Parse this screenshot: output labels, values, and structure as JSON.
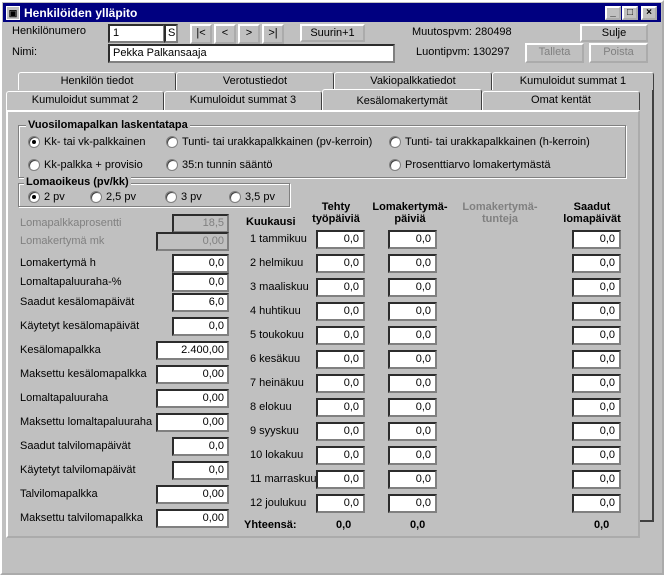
{
  "window": {
    "title": "Henkilöiden ylläpito"
  },
  "header": {
    "employee_number_label": "Henkilönumero",
    "employee_number": "1",
    "s_label": "S",
    "nav_first": "|<",
    "nav_prev": "<",
    "nav_next": ">",
    "nav_last": ">|",
    "largest_button": "Suurin+1",
    "modified_label": "Muutospvm: 280498",
    "close_button": "Sulje",
    "name_label": "Nimi:",
    "name_value": "Pekka Palkansaaja",
    "created_label": "Luontipvm: 130297",
    "save_button": "Talleta",
    "delete_button": "Poista"
  },
  "tabs_back": [
    "Henkilön tiedot",
    "Verotustiedot",
    "Vakiopalkkatiedot",
    "Kumuloidut summat 1"
  ],
  "tabs_front": [
    "Kumuloidut summat 2",
    "Kumuloidut summat 3",
    "Kesälomakertymät",
    "Omat kentät"
  ],
  "calc_group": {
    "title": "Vuosilomapalkan laskentatapa",
    "options": [
      "Kk- tai vk-palkkainen",
      "Tunti- tai urakkapalkkainen (pv-kerroin)",
      "Tunti- tai urakkapalkkainen (h-kerroin)",
      "Kk-palkka + provisio",
      "35:n tunnin sääntö",
      "Prosenttiarvo lomakertymästä"
    ]
  },
  "leave_group": {
    "title": "Lomaoikeus (pv/kk)",
    "options": [
      "2 pv",
      "2,5 pv",
      "3 pv",
      "3,5 pv"
    ]
  },
  "fields": [
    {
      "label": "Lomapalkkaprosentti",
      "value": "18,5"
    },
    {
      "label": "Lomakertymä mk",
      "value": "0,00"
    },
    {
      "label": "Lomakertymä h",
      "value": "0,0"
    },
    {
      "label": "Lomaltapaluuraha-%",
      "value": "0,0"
    },
    {
      "label": "Saadut kesälomapäivät",
      "value": "6,0"
    },
    {
      "label": "Käytetyt kesälomapäivät",
      "value": "0,0"
    },
    {
      "label": "Kesälomapalkka",
      "value": "2.400,00"
    },
    {
      "label": "Maksettu kesälomapalkka",
      "value": "0,00"
    },
    {
      "label": "Lomaltapaluuraha",
      "value": "0,00"
    },
    {
      "label": "Maksettu lomaltapaluuraha",
      "value": "0,00"
    },
    {
      "label": "Saadut talvilomapäivät",
      "value": "0,0"
    },
    {
      "label": "Käytetyt talvilomapäivät",
      "value": "0,0"
    },
    {
      "label": "Talvilomapalkka",
      "value": "0,00"
    },
    {
      "label": "Maksettu talvilomapalkka",
      "value": "0,00"
    }
  ],
  "table": {
    "col_month": "Kuukausi",
    "col_worked_1": "Tehty",
    "col_worked_2": "työpäiviä",
    "col_days_1": "Lomakertymä-",
    "col_days_2": "päiviä",
    "col_hours_1": "Lomakertymä-",
    "col_hours_2": "tunteja",
    "col_received_1": "Saadut",
    "col_received_2": "lomapäivät",
    "months": [
      "1 tammikuu",
      "2 helmikuu",
      "3 maaliskuu",
      "4 huhtikuu",
      "5 toukokuu",
      "6 kesäkuu",
      "7 heinäkuu",
      "8 elokuu",
      "9 syyskuu",
      "10 lokakuu",
      "11 marraskuu",
      "12 joulukuu"
    ],
    "cell_value": "0,0",
    "total_label": "Yhteensä:",
    "total_worked": "0,0",
    "total_days": "0,0",
    "total_received": "0,0"
  }
}
